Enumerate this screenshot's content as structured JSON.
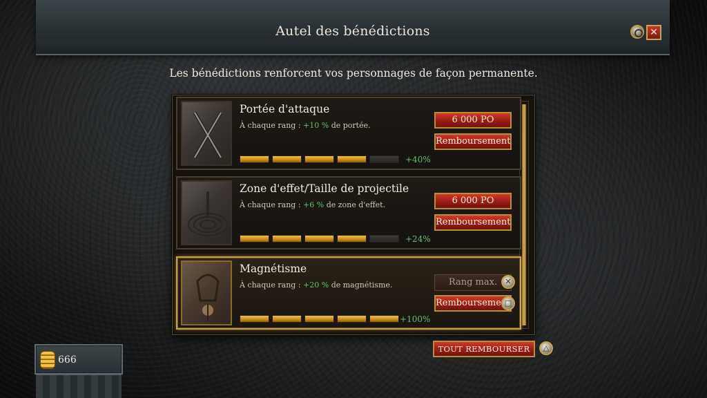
{
  "header": {
    "title": "Autel des bénédictions"
  },
  "subtitle": "Les bénédictions renforcent vos personnages de façon permanente.",
  "blessings": [
    {
      "name": "Portée d'attaque",
      "desc_prefix": "À chaque rang : ",
      "desc_pct": "+10 %",
      "desc_suffix": " de portée.",
      "bonus": "+40%",
      "rank_fraction": 0.8,
      "action_label": "6 000 PO",
      "refund_label": "Remboursement"
    },
    {
      "name": "Zone d'effet/Taille de projectile",
      "desc_prefix": "À chaque rang : ",
      "desc_pct": "+6 %",
      "desc_suffix": " de zone d'effet.",
      "bonus": "+24%",
      "rank_fraction": 0.8,
      "action_label": "6 000 PO",
      "refund_label": "Remboursement"
    },
    {
      "name": "Magnétisme",
      "desc_prefix": "À chaque rang : ",
      "desc_pct": "+20 %",
      "desc_suffix": " de magnétisme.",
      "bonus": "+100%",
      "rank_fraction": 1.0,
      "action_label": "Rang max.",
      "refund_label": "Remboursement"
    }
  ],
  "refund_all_label": "TOUT REMBOURSER",
  "gold": "666",
  "icons": {
    "top_settings": "gamepad-circle-icon",
    "top_close": "close-icon",
    "max_rank_button": "cross-button-icon",
    "refund_button": "square-button-icon",
    "refund_all_button": "triangle-button-icon",
    "gold": "coin-stack-icon"
  },
  "colors": {
    "accent_red": "#b3271b",
    "gold_frame": "#c8a24a",
    "bonus_green": "#63c06a"
  }
}
